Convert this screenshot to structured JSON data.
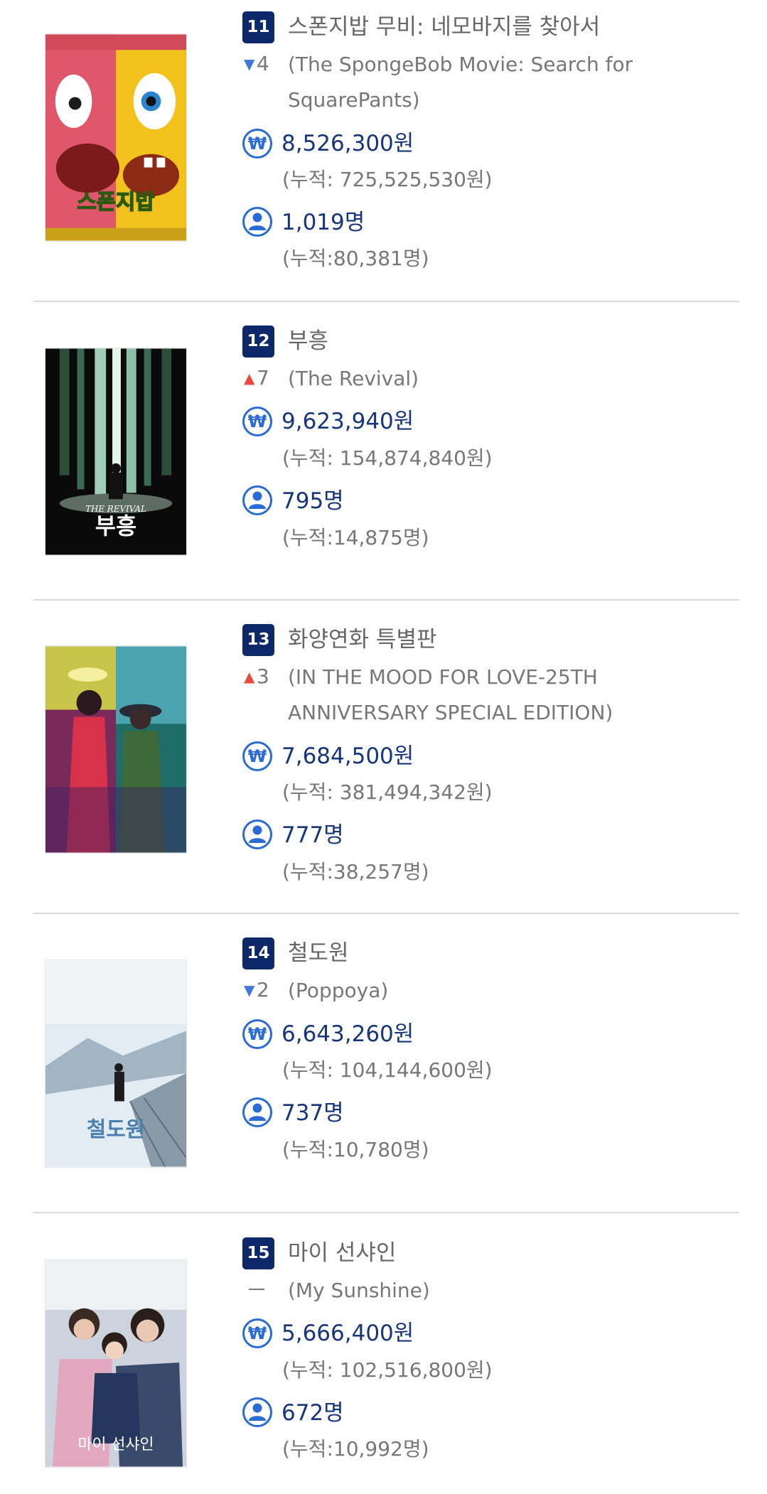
{
  "entries": [
    {
      "rank": "11",
      "title_ko": "스폰지밥 무비: 네모바지를 찾아서",
      "change_dir": "down",
      "change": "4",
      "title_en_lines": [
        "(The SpongeBob Movie: Search for",
        "SquarePants)"
      ],
      "revenue": "8,526,300원",
      "revenue_cum": "(누적: 725,525,530원)",
      "audience": "1,019명",
      "audience_cum": "(누적:80,381명)"
    },
    {
      "rank": "12",
      "title_ko": "부흥",
      "change_dir": "up",
      "change": "7",
      "title_en_lines": [
        "(The Revival)"
      ],
      "revenue": "9,623,940원",
      "revenue_cum": "(누적: 154,874,840원)",
      "audience": "795명",
      "audience_cum": "(누적:14,875명)"
    },
    {
      "rank": "13",
      "title_ko": "화양연화 특별판",
      "change_dir": "up",
      "change": "3",
      "title_en_lines": [
        "(IN THE MOOD FOR LOVE-25TH",
        "ANNIVERSARY SPECIAL EDITION)"
      ],
      "revenue": "7,684,500원",
      "revenue_cum": "(누적: 381,494,342원)",
      "audience": "777명",
      "audience_cum": "(누적:38,257명)"
    },
    {
      "rank": "14",
      "title_ko": "철도원",
      "change_dir": "down",
      "change": "2",
      "title_en_lines": [
        "(Poppoya)"
      ],
      "revenue": "6,643,260원",
      "revenue_cum": "(누적: 104,144,600원)",
      "audience": "737명",
      "audience_cum": "(누적:10,780명)"
    },
    {
      "rank": "15",
      "title_ko": "마이 선샤인",
      "change_dir": "none",
      "change": "",
      "title_en_lines": [
        "(My Sunshine)"
      ],
      "revenue": "5,666,400원",
      "revenue_cum": "(누적: 102,516,800원)",
      "audience": "672명",
      "audience_cum": "(누적:10,992명)"
    }
  ],
  "poster_text": {
    "e0": "스폰지밥",
    "e1_title": "THE REVIVAL",
    "e1_ko": "부흥",
    "e3": "철도원",
    "e4": "마이 선샤인"
  },
  "icons": {
    "currency": "won-icon",
    "audience": "person-icon",
    "up": "arrow-up-icon",
    "down": "arrow-down-icon"
  },
  "won_symbol": "₩",
  "colors": {
    "badge": "#0d2868",
    "icon": "#2b6bd4",
    "value_text": "#17357a",
    "up": "#e84a3b",
    "down": "#3f78d6",
    "muted_text": "#777777"
  }
}
